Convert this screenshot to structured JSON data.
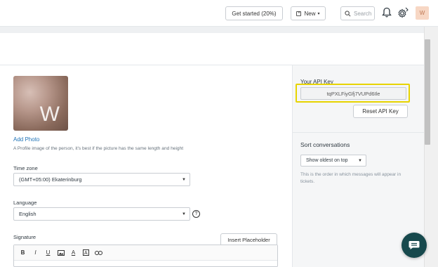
{
  "header": {
    "getting_started_label": "Get started (20%)",
    "new_label": "New",
    "search_placeholder": "Search",
    "avatar_initial": "W"
  },
  "profile": {
    "photo_initial": "W",
    "add_photo_label": "Add Photo",
    "photo_hint": "A Profile image of the person, it's best if the picture has the same length and height"
  },
  "time_zone": {
    "label": "Time zone",
    "value": "(GMT+05:00) Ekaterinburg"
  },
  "language": {
    "label": "Language",
    "value": "English",
    "help_icon": "?"
  },
  "signature": {
    "label": "Signature",
    "insert_placeholder_label": "Insert Placeholder",
    "toolbar": [
      "B",
      "I",
      "U",
      "image",
      "A",
      "text-color",
      "link"
    ]
  },
  "api": {
    "label": "Your API Key",
    "key": "tqPXLFiyGfj7VUPd6Ile",
    "reset_label": "Reset API Key",
    "highlight_color": "#e7d400"
  },
  "sort": {
    "title": "Sort conversations",
    "value": "Show oldest on top",
    "note": "This is the order in which messages will appear in tickets."
  },
  "colors": {
    "chat_button": "#17494d",
    "link": "#1f73b7"
  }
}
